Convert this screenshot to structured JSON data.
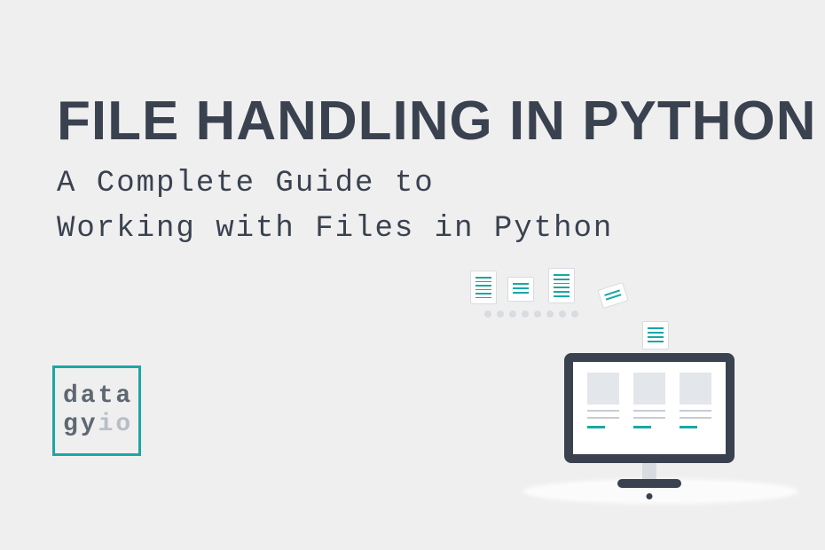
{
  "title": "FILE HANDLING IN PYTHON",
  "subtitle_line1": "A Complete Guide to",
  "subtitle_line2": "Working with Files in Python",
  "logo": {
    "line1": "data",
    "line2_prefix": "gy",
    "line2_suffix": "io"
  },
  "colors": {
    "accent": "#1ba7a5",
    "dark": "#3a4250",
    "background": "#efefef",
    "muted": "#b8bec5"
  }
}
